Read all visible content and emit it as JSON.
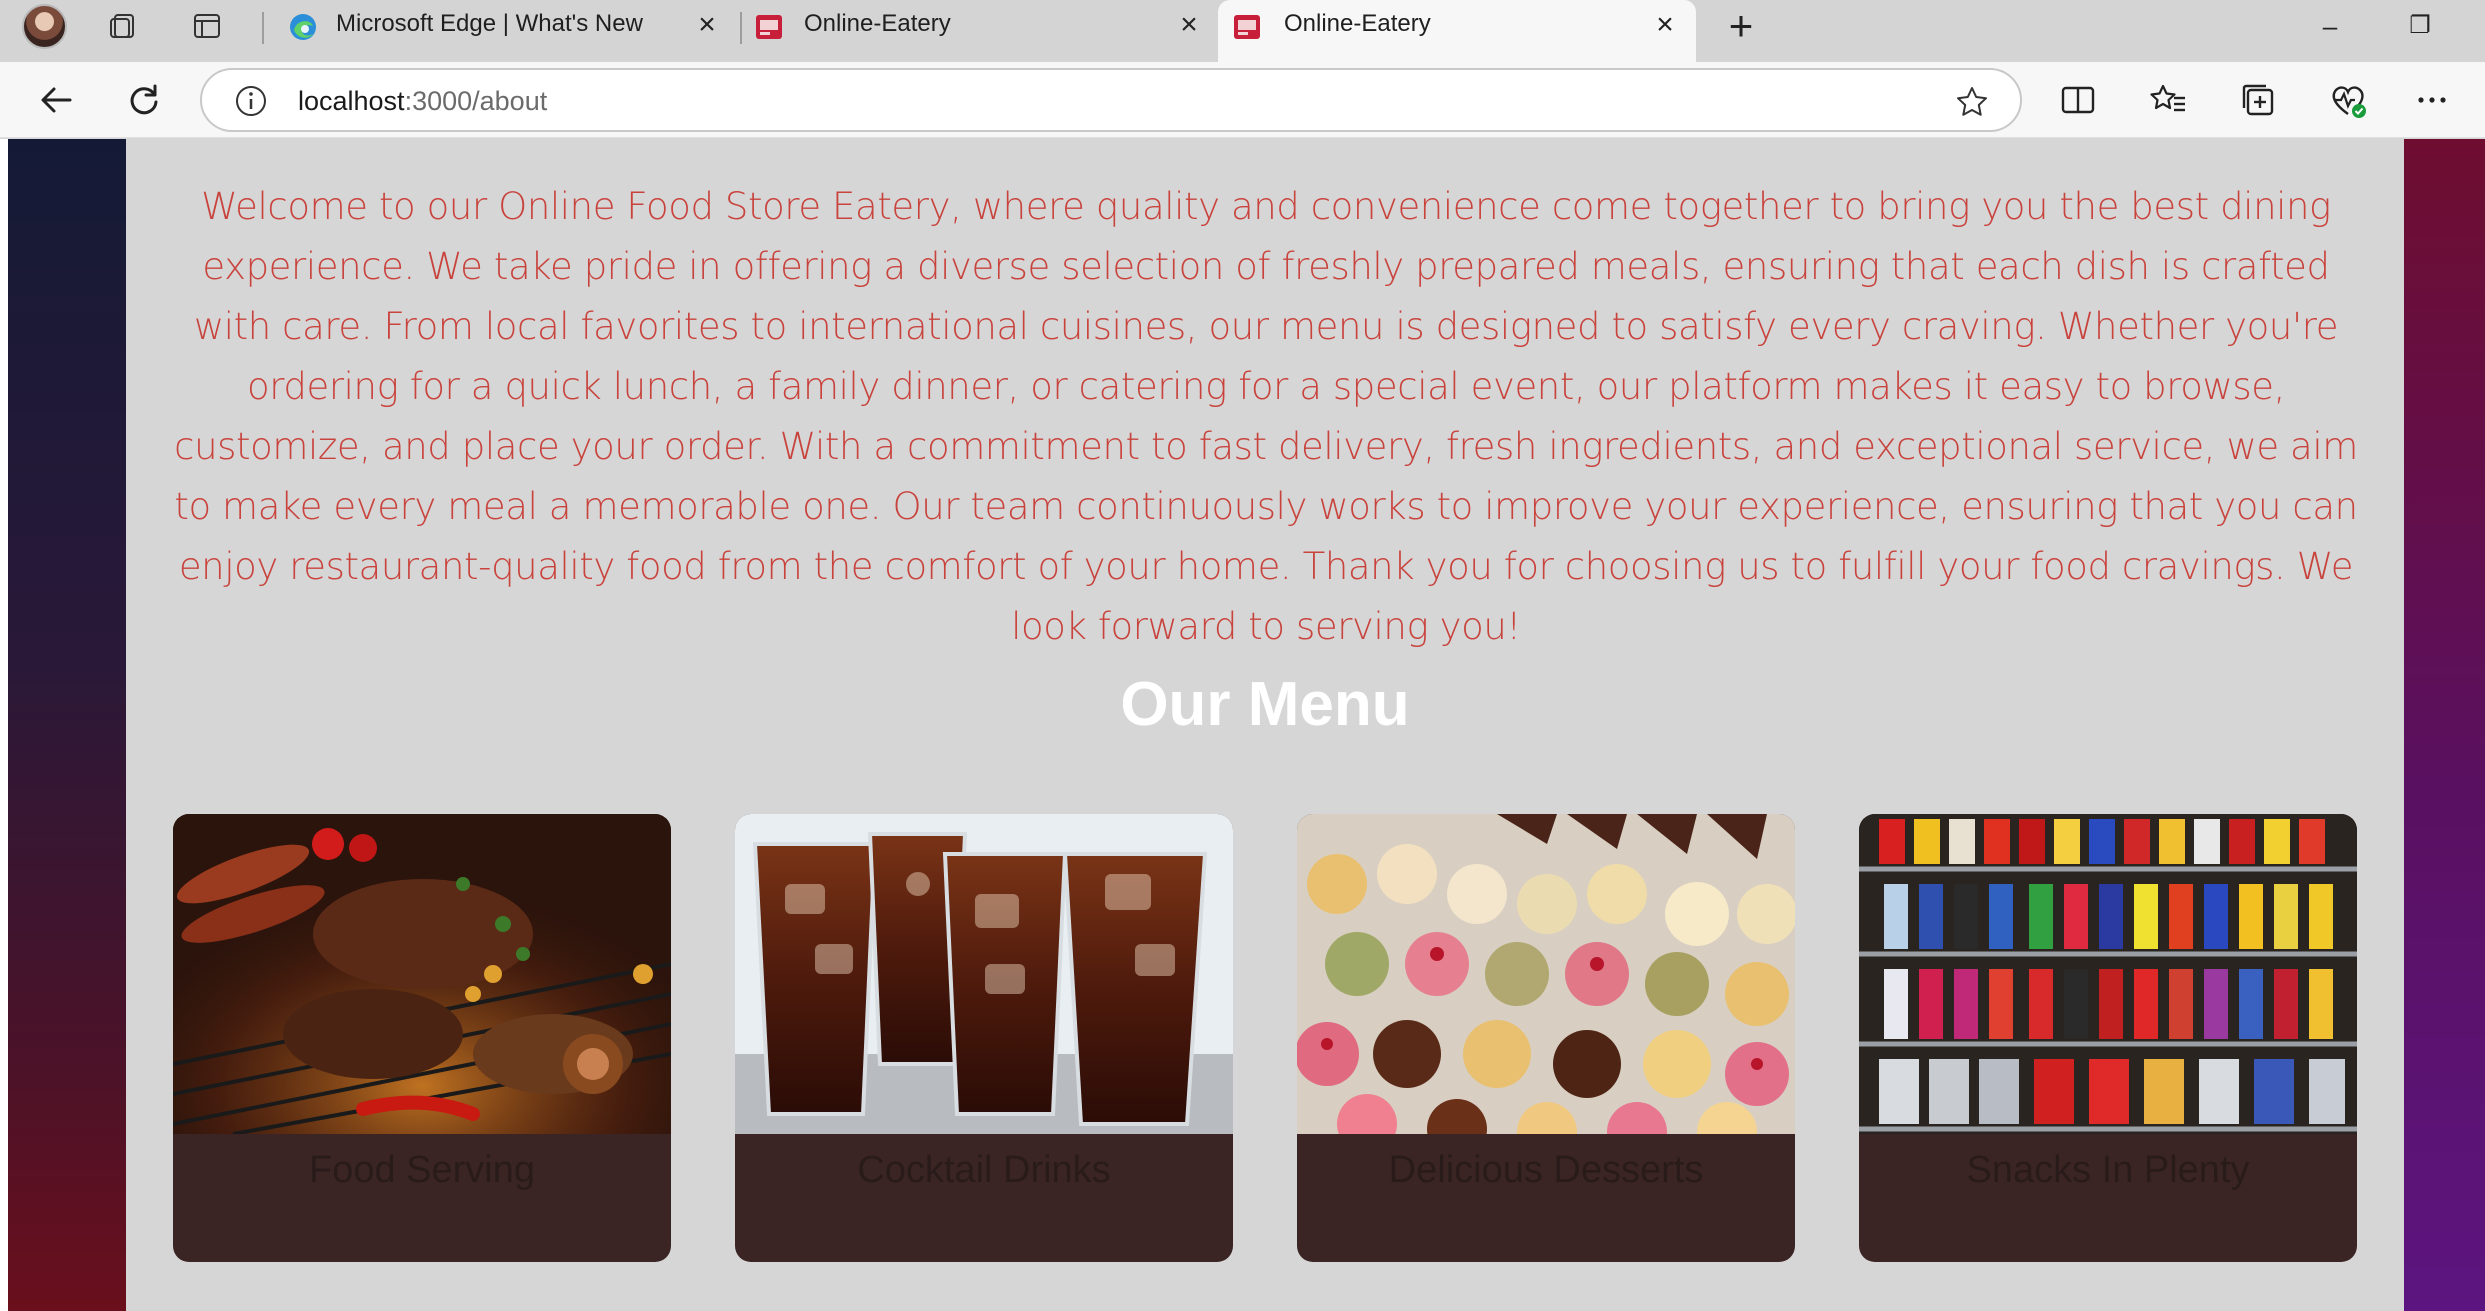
{
  "browser": {
    "tabs": [
      {
        "title": "Microsoft Edge | What's New",
        "favicon": "edge-logo-icon",
        "active": false
      },
      {
        "title": "Online-Eatery",
        "favicon": "site-favicon-icon",
        "active": false
      },
      {
        "title": "Online-Eatery",
        "favicon": "site-favicon-icon",
        "active": true
      }
    ],
    "new_tab_label": "+",
    "address": {
      "host": "localhost",
      "path": ":3000/about"
    },
    "window_controls": {
      "minimize": "–",
      "restore": "❐"
    }
  },
  "page": {
    "about_text": "Welcome to our Online Food Store Eatery, where quality and convenience come together to bring you the best dining experience. We take pride in offering a diverse selection of freshly prepared meals, ensuring that each dish is crafted with care. From local favorites to international cuisines, our menu is designed to satisfy every craving. Whether you're ordering for a quick lunch, a family dinner, or catering for a special event, our platform makes it easy to browse, customize, and place your order. With a commitment to fast delivery, fresh ingredients, and exceptional service, we aim to make every meal a memorable one. Our team continuously works to improve your experience, ensuring that you can enjoy restaurant-quality food from the comfort of your home. Thank you for choosing us to fulfill your food cravings. We look forward to serving you!",
    "menu_title": "Our Menu",
    "menu_cards": [
      {
        "label": "Food Serving",
        "image": "grilled-meats-photo"
      },
      {
        "label": "Cocktail Drinks",
        "image": "iced-drinks-photo"
      },
      {
        "label": "Delicious Desserts",
        "image": "desserts-photo"
      },
      {
        "label": "Snacks In Plenty",
        "image": "vending-snacks-photo"
      }
    ]
  },
  "colors": {
    "about_text": "#c9433d",
    "content_bg": "#d6d6d6",
    "card_footer": "#3b2524",
    "menu_title": "#ffffff"
  }
}
